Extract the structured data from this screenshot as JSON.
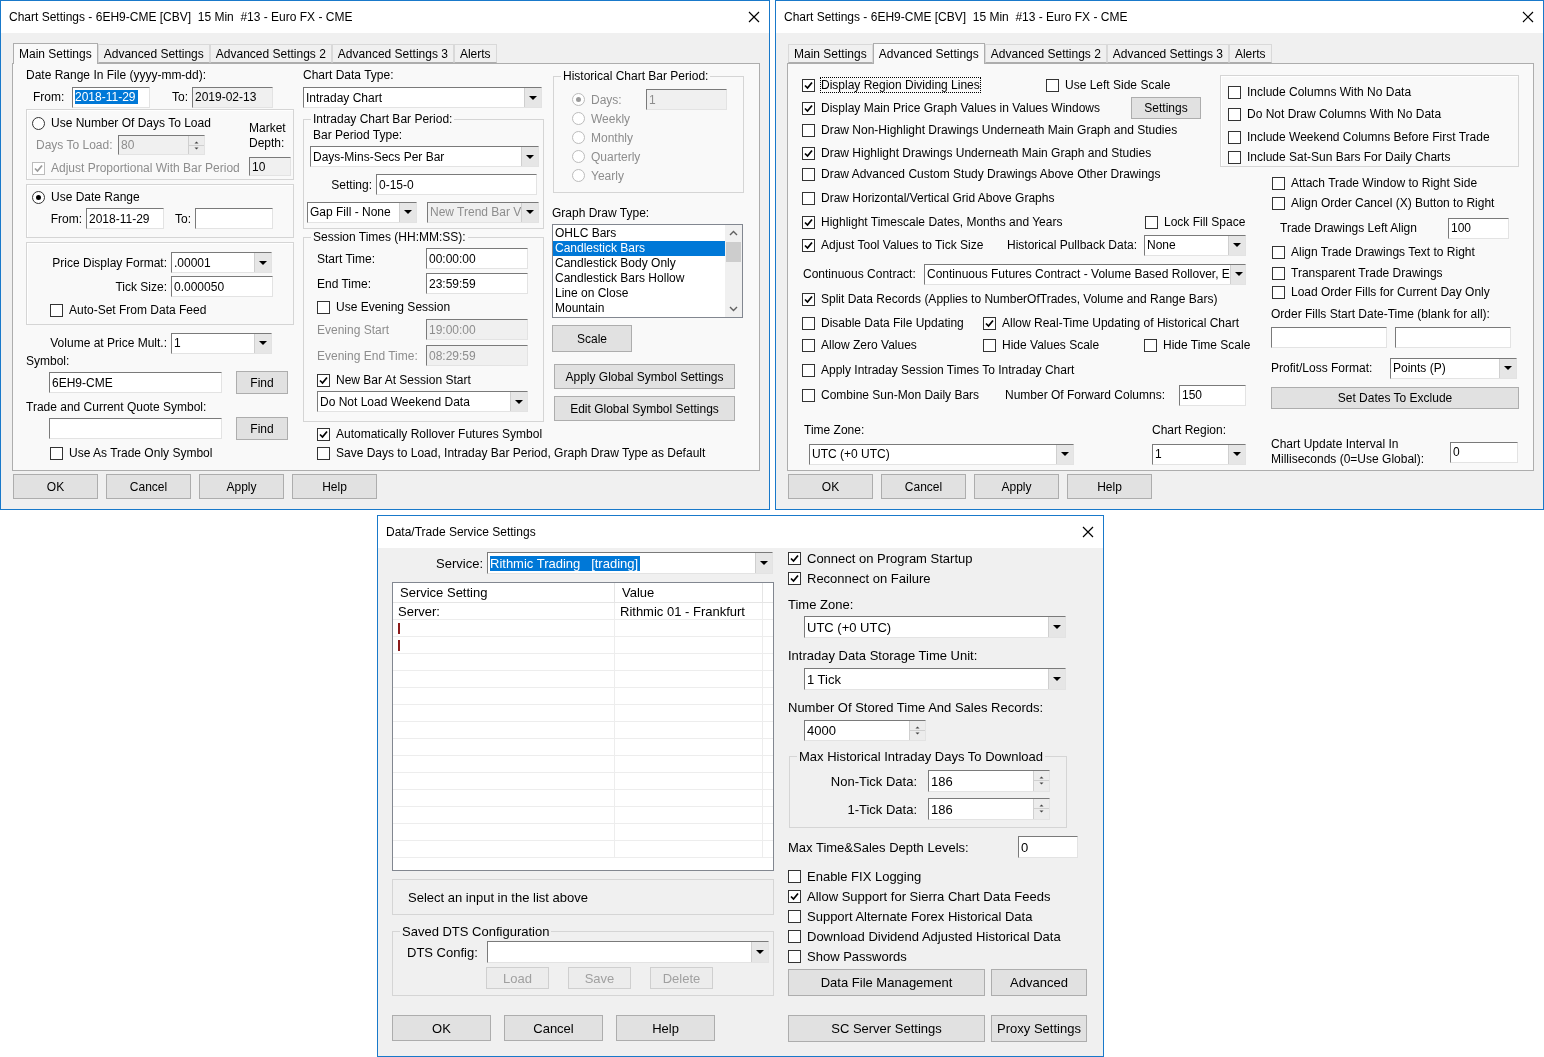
{
  "chart_settings_main": {
    "title": "Chart Settings - 6EH9-CME [CBV]  15 Min  #13 - Euro FX - CME",
    "tabs": [
      {
        "label": "Main Settings",
        "selected": true
      },
      {
        "label": "Advanced Settings",
        "selected": false
      },
      {
        "label": "Advanced Settings 2",
        "selected": false
      },
      {
        "label": "Advanced Settings 3",
        "selected": false
      },
      {
        "label": "Alerts",
        "selected": false
      }
    ],
    "date_range_label": "Date Range In File (yyyy-mm-dd):",
    "file_from": {
      "label": "From:",
      "value": "2018-11-29",
      "highlighted": true
    },
    "file_to": {
      "label": "To:",
      "value": "2019-02-13",
      "read_only": true
    },
    "use_days": {
      "label": "Use Number Of Days To Load",
      "selected": false
    },
    "days_to_load": {
      "label": "Days To Load:",
      "value": "80",
      "disabled": true
    },
    "adjust_proportional": {
      "label": "Adjust Proportional With Bar Period",
      "checked": true,
      "disabled": true
    },
    "market_depth": {
      "label": "Market Depth:",
      "value": "10",
      "read_only": true
    },
    "use_date_range": {
      "label": "Use Date Range",
      "selected": true
    },
    "range_from": {
      "label": "From:",
      "value": "2018-11-29"
    },
    "range_to": {
      "label": "To:"
    },
    "price_display_format": {
      "label": "Price Display Format:",
      "value": ".00001"
    },
    "tick_size": {
      "label": "Tick Size:",
      "value": "0.000050"
    },
    "auto_set": {
      "label": "Auto-Set From Data Feed",
      "checked": false
    },
    "volume_at_price_mult": {
      "label": "Volume at Price Mult.:",
      "value": "1"
    },
    "symbol": {
      "label": "Symbol:",
      "value": "6EH9-CME",
      "button": "Find"
    },
    "trade_symbol": {
      "label": "Trade and Current Quote Symbol:",
      "button": "Find"
    },
    "trade_only": {
      "label": "Use As Trade Only Symbol",
      "checked": false
    },
    "chart_data_type": {
      "label": "Chart Data Type:",
      "value": "Intraday Chart"
    },
    "intraday_group": "Intraday Chart Bar Period:",
    "bar_period_type": {
      "label": "Bar Period Type:",
      "value": "Days-Mins-Secs Per Bar"
    },
    "setting": {
      "label": "Setting:",
      "value": "0-15-0"
    },
    "gap_fill": {
      "value": "Gap Fill - None"
    },
    "new_trend_bar": {
      "value": "New Trend Bar V",
      "disabled": true
    },
    "session_group": "Session Times (HH:MM:SS):",
    "start_time": {
      "label": "Start Time:",
      "value": "00:00:00"
    },
    "end_time": {
      "label": "End Time:",
      "value": "23:59:59"
    },
    "use_evening": {
      "label": "Use Evening Session",
      "checked": false
    },
    "evening_start": {
      "label": "Evening Start",
      "value": "19:00:00",
      "disabled": true
    },
    "evening_end": {
      "label": "Evening End Time:",
      "value": "08:29:59",
      "disabled": true
    },
    "new_bar": {
      "label": "New Bar At Session Start",
      "checked": true
    },
    "weekend": {
      "value": "Do Not Load Weekend Data"
    },
    "auto_rollover": {
      "label": "Automatically Rollover Futures Symbol",
      "checked": true
    },
    "save_default": {
      "label": "Save Days to Load, Intraday Bar Period, Graph Draw Type as Default",
      "checked": false
    },
    "historical_group": "Historical Chart Bar Period:",
    "historical_options": [
      {
        "label": "Days:",
        "selected": true,
        "disabled": true
      },
      {
        "label": "Weekly",
        "selected": false,
        "disabled": true
      },
      {
        "label": "Monthly",
        "selected": false,
        "disabled": true
      },
      {
        "label": "Quarterly",
        "selected": false,
        "disabled": true
      },
      {
        "label": "Yearly",
        "selected": false,
        "disabled": true
      }
    ],
    "historical_days": {
      "value": "1",
      "disabled": true
    },
    "graph_draw_type": {
      "label": "Graph Draw Type:",
      "items": [
        {
          "label": "OHLC Bars",
          "selected": false
        },
        {
          "label": "Candlestick Bars",
          "selected": true
        },
        {
          "label": "Candlestick Body Only",
          "selected": false
        },
        {
          "label": "Candlestick Bars Hollow",
          "selected": false
        },
        {
          "label": "Line on Close",
          "selected": false
        },
        {
          "label": "Mountain",
          "selected": false
        }
      ]
    },
    "scale_button": "Scale",
    "global_buttons": [
      "Apply Global Symbol Settings",
      "Edit Global Symbol Settings"
    ],
    "footer_buttons": [
      "OK",
      "Cancel",
      "Apply",
      "Help"
    ]
  },
  "chart_settings_advanced": {
    "title": "Chart Settings - 6EH9-CME [CBV]  15 Min  #13 - Euro FX - CME",
    "tabs": [
      {
        "label": "Main Settings",
        "selected": false
      },
      {
        "label": "Advanced Settings",
        "selected": true
      },
      {
        "label": "Advanced Settings 2",
        "selected": false
      },
      {
        "label": "Advanced Settings 3",
        "selected": false
      },
      {
        "label": "Alerts",
        "selected": false
      }
    ],
    "display_region": {
      "label": "Display Region Dividing Lines",
      "checked": true,
      "focused": true
    },
    "left_side_scale": {
      "label": "Use Left Side Scale",
      "checked": false
    },
    "main_price_values": {
      "label": "Display Main Price Graph Values in Values Windows",
      "checked": true
    },
    "settings_button": "Settings",
    "non_highlight_under": {
      "label": "Draw Non-Highlight Drawings Underneath Main Graph and Studies",
      "checked": false
    },
    "highlight_under": {
      "label": "Draw Highlight Drawings Underneath Main Graph and Studies",
      "checked": true
    },
    "custom_study_above": {
      "label": "Draw Advanced Custom Study Drawings Above Other Drawings",
      "checked": false
    },
    "grid_above": {
      "label": "Draw Horizontal/Vertical Grid Above Graphs",
      "checked": false
    },
    "highlight_timescale": {
      "label": "Highlight Timescale Dates, Months and Years",
      "checked": true
    },
    "lock_fill": {
      "label": "Lock Fill Space",
      "checked": false
    },
    "adjust_tool": {
      "label": "Adjust Tool Values to Tick Size",
      "checked": true
    },
    "pullback": {
      "label": "Historical Pullback Data:",
      "value": "None"
    },
    "continuous": {
      "label": "Continuous Contract:",
      "value": "Continuous Futures Contract - Volume Based Rollover, E"
    },
    "split_records": {
      "label": "Split Data Records (Applies to NumberOfTrades, Volume and Range Bars)",
      "checked": true
    },
    "disable_updating": {
      "label": "Disable Data File Updating",
      "checked": false
    },
    "allow_realtime": {
      "label": "Allow Real-Time Updating of Historical Chart",
      "checked": true
    },
    "allow_zero": {
      "label": "Allow Zero Values",
      "checked": false
    },
    "hide_values_scale": {
      "label": "Hide Values Scale",
      "checked": false
    },
    "hide_time_scale": {
      "label": "Hide Time Scale",
      "checked": false
    },
    "apply_session": {
      "label": "Apply Intraday Session Times To Intraday Chart",
      "checked": false
    },
    "combine_sun_mon": {
      "label": "Combine Sun-Mon Daily Bars",
      "checked": false
    },
    "forward_columns": {
      "label": "Number Of Forward Columns:",
      "value": "150"
    },
    "time_zone": {
      "label": "Time Zone:",
      "value": "UTC (+0 UTC)"
    },
    "chart_region": {
      "label": "Chart Region:",
      "value": "1"
    },
    "column_options": [
      {
        "label": "Include Columns With No Data",
        "checked": false
      },
      {
        "label": "Do Not Draw Columns With No Data",
        "checked": false
      },
      {
        "label": "Include Weekend Columns Before First Trade",
        "checked": false
      },
      {
        "label": "Include Sat-Sun Bars For Daily Charts",
        "checked": false
      }
    ],
    "trade_options": [
      {
        "label": "Attach Trade Window to Right Side",
        "checked": false
      },
      {
        "label": "Align Order Cancel (X) Button to Right",
        "checked": false
      }
    ],
    "trade_left_align": {
      "label": "Trade Drawings Left Align",
      "value": "100"
    },
    "trade_drawing_options": [
      {
        "label": "Align Trade Drawings Text to Right",
        "checked": false
      },
      {
        "label": "Transparent Trade Drawings",
        "checked": false
      },
      {
        "label": "Load Order Fills for Current Day Only",
        "checked": false
      }
    ],
    "order_fills_label": "Order Fills Start Date-Time (blank for all):",
    "pl_format": {
      "label": "Profit/Loss Format:",
      "value": "Points (P)"
    },
    "exclude_button": "Set Dates To Exclude",
    "update_interval": {
      "label": "Chart Update Interval In Milliseconds (0=Use Global):",
      "value": "0"
    },
    "footer_buttons": [
      "OK",
      "Cancel",
      "Apply",
      "Help"
    ]
  },
  "data_trade_service": {
    "title": "Data/Trade Service Settings",
    "service": {
      "label": "Service:",
      "value": "Rithmic Trading   [trading]",
      "highlighted": true
    },
    "table": {
      "columns": [
        "Service Setting",
        "Value"
      ],
      "rows": [
        {
          "kind": "entry",
          "setting": "Server:",
          "value": "Rithmic 01 - Frankfurt"
        },
        {
          "kind": "cursor"
        },
        {
          "kind": "cursor"
        }
      ]
    },
    "hint": "Select an input in the list above",
    "dts_group": "Saved DTS Configuration",
    "dts_config": {
      "label": "DTS Config:"
    },
    "dts_buttons": [
      {
        "label": "Load",
        "disabled": true
      },
      {
        "label": "Save",
        "disabled": true
      },
      {
        "label": "Delete",
        "disabled": true
      }
    ],
    "footer_buttons": [
      "OK",
      "Cancel",
      "Help"
    ],
    "connect_options": [
      {
        "label": "Connect on Program Startup",
        "checked": true
      },
      {
        "label": "Reconnect on Failure",
        "checked": true
      }
    ],
    "time_zone": {
      "label": "Time Zone:",
      "value": "UTC (+0 UTC)"
    },
    "storage_unit": {
      "label": "Intraday Data Storage Time Unit:",
      "value": "1 Tick"
    },
    "stored_records": {
      "label": "Number Of Stored Time And Sales Records:",
      "value": "4000"
    },
    "max_days_group": "Max Historical Intraday Days To Download",
    "non_tick": {
      "label": "Non-Tick Data:",
      "value": "186"
    },
    "one_tick": {
      "label": "1-Tick Data:",
      "value": "186"
    },
    "depth_levels": {
      "label": "Max Time&Sales Depth Levels:",
      "value": "0"
    },
    "options": [
      {
        "label": "Enable FIX Logging",
        "checked": false
      },
      {
        "label": "Allow Support for Sierra Chart Data Feeds",
        "checked": true
      },
      {
        "label": "Support Alternate Forex Historical Data",
        "checked": false
      },
      {
        "label": "Download Dividend Adjusted Historical Data",
        "checked": false
      },
      {
        "label": "Show Passwords",
        "checked": false
      }
    ],
    "buttons": [
      "Data File Management",
      "Advanced",
      "SC Server Settings",
      "Proxy Settings"
    ]
  }
}
